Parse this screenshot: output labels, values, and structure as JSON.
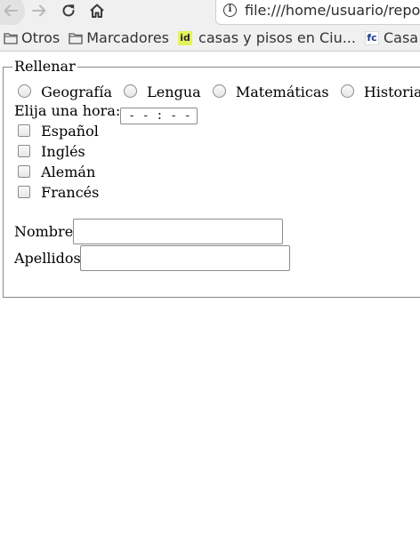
{
  "browser": {
    "url": "file:///home/usuario/repo",
    "bookmarks": [
      {
        "label": "Otros",
        "icon": "folder-icon"
      },
      {
        "label": "Marcadores",
        "icon": "folder-icon"
      },
      {
        "label": "casas y pisos en Ciu...",
        "icon": "idealista-favicon",
        "favicon_text": "id"
      },
      {
        "label": "Casa",
        "icon": "fotocasa-favicon",
        "favicon_text": "fc"
      }
    ]
  },
  "form": {
    "legend": "Rellenar",
    "subjects": [
      "Geografía",
      "Lengua",
      "Matemáticas",
      "Historia"
    ],
    "time_label": "Elija una hora:",
    "time_placeholder": "- - : - -",
    "languages": [
      "Español",
      "Inglés",
      "Alemán",
      "Francés"
    ],
    "name_label": "Nombre",
    "name_value": "",
    "surname_label": "Apellidos",
    "surname_value": ""
  },
  "colors": {
    "toolbar_bg": "#f0f0f0",
    "border": "#888888",
    "idealista_favicon_bg": "#e3f35a",
    "fotocasa_text": "#1a3b8c"
  }
}
